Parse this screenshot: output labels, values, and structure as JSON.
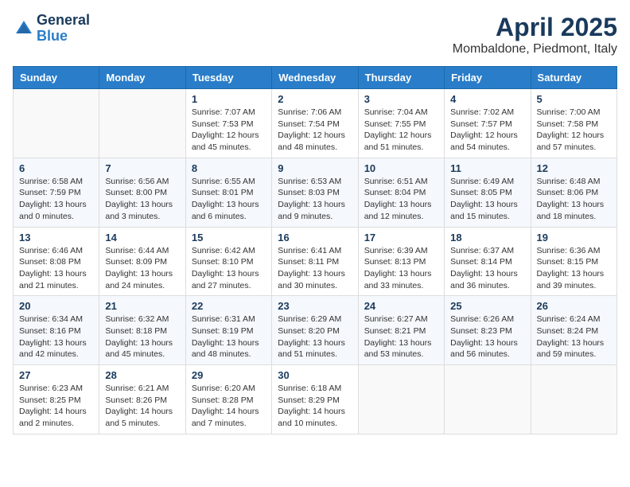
{
  "logo": {
    "general": "General",
    "blue": "Blue"
  },
  "header": {
    "month": "April 2025",
    "location": "Mombaldone, Piedmont, Italy"
  },
  "weekdays": [
    "Sunday",
    "Monday",
    "Tuesday",
    "Wednesday",
    "Thursday",
    "Friday",
    "Saturday"
  ],
  "weeks": [
    [
      {
        "day": "",
        "info": ""
      },
      {
        "day": "",
        "info": ""
      },
      {
        "day": "1",
        "info": "Sunrise: 7:07 AM\nSunset: 7:53 PM\nDaylight: 12 hours and 45 minutes."
      },
      {
        "day": "2",
        "info": "Sunrise: 7:06 AM\nSunset: 7:54 PM\nDaylight: 12 hours and 48 minutes."
      },
      {
        "day": "3",
        "info": "Sunrise: 7:04 AM\nSunset: 7:55 PM\nDaylight: 12 hours and 51 minutes."
      },
      {
        "day": "4",
        "info": "Sunrise: 7:02 AM\nSunset: 7:57 PM\nDaylight: 12 hours and 54 minutes."
      },
      {
        "day": "5",
        "info": "Sunrise: 7:00 AM\nSunset: 7:58 PM\nDaylight: 12 hours and 57 minutes."
      }
    ],
    [
      {
        "day": "6",
        "info": "Sunrise: 6:58 AM\nSunset: 7:59 PM\nDaylight: 13 hours and 0 minutes."
      },
      {
        "day": "7",
        "info": "Sunrise: 6:56 AM\nSunset: 8:00 PM\nDaylight: 13 hours and 3 minutes."
      },
      {
        "day": "8",
        "info": "Sunrise: 6:55 AM\nSunset: 8:01 PM\nDaylight: 13 hours and 6 minutes."
      },
      {
        "day": "9",
        "info": "Sunrise: 6:53 AM\nSunset: 8:03 PM\nDaylight: 13 hours and 9 minutes."
      },
      {
        "day": "10",
        "info": "Sunrise: 6:51 AM\nSunset: 8:04 PM\nDaylight: 13 hours and 12 minutes."
      },
      {
        "day": "11",
        "info": "Sunrise: 6:49 AM\nSunset: 8:05 PM\nDaylight: 13 hours and 15 minutes."
      },
      {
        "day": "12",
        "info": "Sunrise: 6:48 AM\nSunset: 8:06 PM\nDaylight: 13 hours and 18 minutes."
      }
    ],
    [
      {
        "day": "13",
        "info": "Sunrise: 6:46 AM\nSunset: 8:08 PM\nDaylight: 13 hours and 21 minutes."
      },
      {
        "day": "14",
        "info": "Sunrise: 6:44 AM\nSunset: 8:09 PM\nDaylight: 13 hours and 24 minutes."
      },
      {
        "day": "15",
        "info": "Sunrise: 6:42 AM\nSunset: 8:10 PM\nDaylight: 13 hours and 27 minutes."
      },
      {
        "day": "16",
        "info": "Sunrise: 6:41 AM\nSunset: 8:11 PM\nDaylight: 13 hours and 30 minutes."
      },
      {
        "day": "17",
        "info": "Sunrise: 6:39 AM\nSunset: 8:13 PM\nDaylight: 13 hours and 33 minutes."
      },
      {
        "day": "18",
        "info": "Sunrise: 6:37 AM\nSunset: 8:14 PM\nDaylight: 13 hours and 36 minutes."
      },
      {
        "day": "19",
        "info": "Sunrise: 6:36 AM\nSunset: 8:15 PM\nDaylight: 13 hours and 39 minutes."
      }
    ],
    [
      {
        "day": "20",
        "info": "Sunrise: 6:34 AM\nSunset: 8:16 PM\nDaylight: 13 hours and 42 minutes."
      },
      {
        "day": "21",
        "info": "Sunrise: 6:32 AM\nSunset: 8:18 PM\nDaylight: 13 hours and 45 minutes."
      },
      {
        "day": "22",
        "info": "Sunrise: 6:31 AM\nSunset: 8:19 PM\nDaylight: 13 hours and 48 minutes."
      },
      {
        "day": "23",
        "info": "Sunrise: 6:29 AM\nSunset: 8:20 PM\nDaylight: 13 hours and 51 minutes."
      },
      {
        "day": "24",
        "info": "Sunrise: 6:27 AM\nSunset: 8:21 PM\nDaylight: 13 hours and 53 minutes."
      },
      {
        "day": "25",
        "info": "Sunrise: 6:26 AM\nSunset: 8:23 PM\nDaylight: 13 hours and 56 minutes."
      },
      {
        "day": "26",
        "info": "Sunrise: 6:24 AM\nSunset: 8:24 PM\nDaylight: 13 hours and 59 minutes."
      }
    ],
    [
      {
        "day": "27",
        "info": "Sunrise: 6:23 AM\nSunset: 8:25 PM\nDaylight: 14 hours and 2 minutes."
      },
      {
        "day": "28",
        "info": "Sunrise: 6:21 AM\nSunset: 8:26 PM\nDaylight: 14 hours and 5 minutes."
      },
      {
        "day": "29",
        "info": "Sunrise: 6:20 AM\nSunset: 8:28 PM\nDaylight: 14 hours and 7 minutes."
      },
      {
        "day": "30",
        "info": "Sunrise: 6:18 AM\nSunset: 8:29 PM\nDaylight: 14 hours and 10 minutes."
      },
      {
        "day": "",
        "info": ""
      },
      {
        "day": "",
        "info": ""
      },
      {
        "day": "",
        "info": ""
      }
    ]
  ]
}
